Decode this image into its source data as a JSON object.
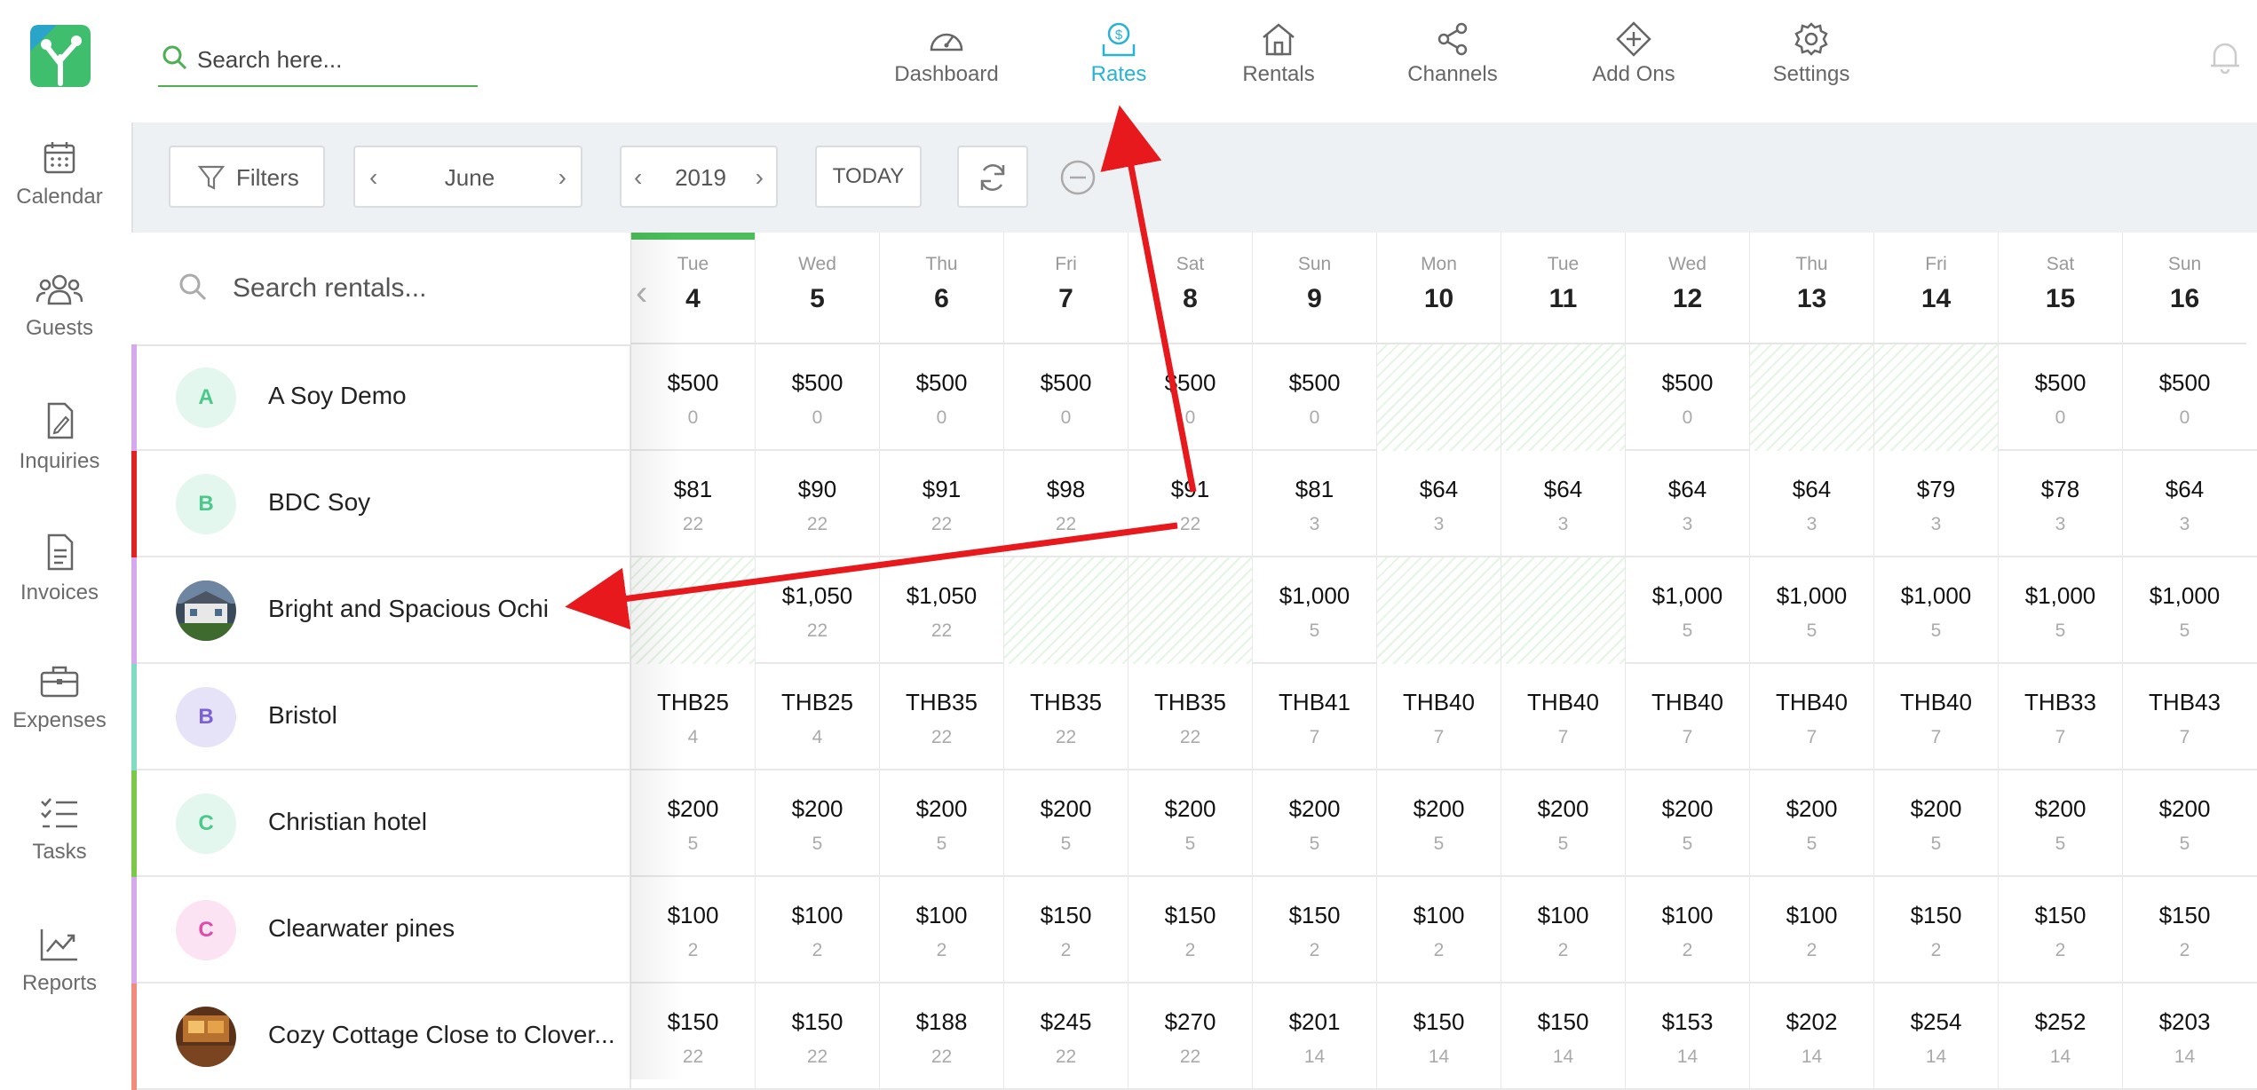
{
  "search": {
    "placeholder": "Search here..."
  },
  "sidebar": {
    "items": [
      {
        "label": "Calendar",
        "icon": "calendar-icon"
      },
      {
        "label": "Guests",
        "icon": "guests-icon"
      },
      {
        "label": "Inquiries",
        "icon": "inquiries-icon"
      },
      {
        "label": "Invoices",
        "icon": "invoices-icon"
      },
      {
        "label": "Expenses",
        "icon": "expenses-icon"
      },
      {
        "label": "Tasks",
        "icon": "tasks-icon"
      },
      {
        "label": "Reports",
        "icon": "reports-icon"
      }
    ]
  },
  "nav": {
    "items": [
      {
        "label": "Dashboard",
        "icon": "dashboard-icon"
      },
      {
        "label": "Rates",
        "icon": "rates-icon",
        "active": true
      },
      {
        "label": "Rentals",
        "icon": "rentals-icon"
      },
      {
        "label": "Channels",
        "icon": "channels-icon"
      },
      {
        "label": "Add Ons",
        "icon": "add-ons-icon"
      },
      {
        "label": "Settings",
        "icon": "settings-icon"
      }
    ],
    "active_color": "#28b3d3"
  },
  "toolbar": {
    "filters_label": "Filters",
    "month": "June",
    "year": "2019",
    "today_label": "TODAY"
  },
  "grid": {
    "rental_search_placeholder": "Search rentals...",
    "days": [
      {
        "dow": "Tue",
        "num": "4"
      },
      {
        "dow": "Wed",
        "num": "5"
      },
      {
        "dow": "Thu",
        "num": "6"
      },
      {
        "dow": "Fri",
        "num": "7"
      },
      {
        "dow": "Sat",
        "num": "8"
      },
      {
        "dow": "Sun",
        "num": "9"
      },
      {
        "dow": "Mon",
        "num": "10"
      },
      {
        "dow": "Tue",
        "num": "11"
      },
      {
        "dow": "Wed",
        "num": "12"
      },
      {
        "dow": "Thu",
        "num": "13"
      },
      {
        "dow": "Fri",
        "num": "14"
      },
      {
        "dow": "Sat",
        "num": "15"
      },
      {
        "dow": "Sun",
        "num": "16"
      }
    ],
    "rentals": [
      {
        "name": "A Soy Demo",
        "avatar": "A",
        "strip": "#d6a8ee",
        "avatar_bg": "#e3f7ee",
        "avatar_fg": "#4cc98a",
        "cells": [
          [
            "$500",
            "0"
          ],
          [
            "$500",
            "0"
          ],
          [
            "$500",
            "0"
          ],
          [
            "$500",
            "0"
          ],
          [
            "$500",
            "0"
          ],
          [
            "$500",
            "0"
          ],
          null,
          null,
          [
            "$500",
            "0"
          ],
          null,
          null,
          [
            "$500",
            "0"
          ],
          [
            "$500",
            "0"
          ]
        ]
      },
      {
        "name": "BDC Soy",
        "avatar": "B",
        "strip": "#e02424",
        "avatar_bg": "#e3f7ee",
        "avatar_fg": "#4cc98a",
        "cells": [
          [
            "$81",
            "22"
          ],
          [
            "$90",
            "22"
          ],
          [
            "$91",
            "22"
          ],
          [
            "$98",
            "22"
          ],
          [
            "$91",
            "22"
          ],
          [
            "$81",
            "3"
          ],
          [
            "$64",
            "3"
          ],
          [
            "$64",
            "3"
          ],
          [
            "$64",
            "3"
          ],
          [
            "$64",
            "3"
          ],
          [
            "$79",
            "3"
          ],
          [
            "$78",
            "3"
          ],
          [
            "$64",
            "3"
          ]
        ]
      },
      {
        "name": "Bright and Spacious Ochi",
        "avatar": "",
        "photo": true,
        "strip": "#d6a8ee",
        "cells": [
          null,
          [
            "$1,050",
            "22"
          ],
          [
            "$1,050",
            "22"
          ],
          null,
          null,
          [
            "$1,000",
            "5"
          ],
          null,
          null,
          [
            "$1,000",
            "5"
          ],
          [
            "$1,000",
            "5"
          ],
          [
            "$1,000",
            "5"
          ],
          [
            "$1,000",
            "5"
          ],
          [
            "$1,000",
            "5"
          ]
        ]
      },
      {
        "name": "Bristol",
        "avatar": "B",
        "strip": "#7fdcc2",
        "avatar_bg": "#e6e2f8",
        "avatar_fg": "#7d5fd8",
        "cells": [
          [
            "THB25",
            "4"
          ],
          [
            "THB25",
            "4"
          ],
          [
            "THB35",
            "22"
          ],
          [
            "THB35",
            "22"
          ],
          [
            "THB35",
            "22"
          ],
          [
            "THB41",
            "7"
          ],
          [
            "THB40",
            "7"
          ],
          [
            "THB40",
            "7"
          ],
          [
            "THB40",
            "7"
          ],
          [
            "THB40",
            "7"
          ],
          [
            "THB40",
            "7"
          ],
          [
            "THB33",
            "7"
          ],
          [
            "THB43",
            "7"
          ]
        ]
      },
      {
        "name": "Christian hotel",
        "avatar": "C",
        "strip": "#7cc84a",
        "avatar_bg": "#e3f7ee",
        "avatar_fg": "#4cc98a",
        "cells": [
          [
            "$200",
            "5"
          ],
          [
            "$200",
            "5"
          ],
          [
            "$200",
            "5"
          ],
          [
            "$200",
            "5"
          ],
          [
            "$200",
            "5"
          ],
          [
            "$200",
            "5"
          ],
          [
            "$200",
            "5"
          ],
          [
            "$200",
            "5"
          ],
          [
            "$200",
            "5"
          ],
          [
            "$200",
            "5"
          ],
          [
            "$200",
            "5"
          ],
          [
            "$200",
            "5"
          ],
          [
            "$200",
            "5"
          ]
        ]
      },
      {
        "name": "Clearwater pines",
        "avatar": "C",
        "strip": "#d6a8ee",
        "avatar_bg": "#fbe3f3",
        "avatar_fg": "#e04aa8",
        "cells": [
          [
            "$100",
            "2"
          ],
          [
            "$100",
            "2"
          ],
          [
            "$100",
            "2"
          ],
          [
            "$150",
            "2"
          ],
          [
            "$150",
            "2"
          ],
          [
            "$150",
            "2"
          ],
          [
            "$100",
            "2"
          ],
          [
            "$100",
            "2"
          ],
          [
            "$100",
            "2"
          ],
          [
            "$100",
            "2"
          ],
          [
            "$150",
            "2"
          ],
          [
            "$150",
            "2"
          ],
          [
            "$150",
            "2"
          ]
        ]
      },
      {
        "name": "Cozy Cottage Close to Clover...",
        "avatar": "",
        "photo": true,
        "strip": "#f08c7e",
        "cells": [
          [
            "$150",
            "22"
          ],
          [
            "$150",
            "22"
          ],
          [
            "$188",
            "22"
          ],
          [
            "$245",
            "22"
          ],
          [
            "$270",
            "22"
          ],
          [
            "$201",
            "14"
          ],
          [
            "$150",
            "14"
          ],
          [
            "$150",
            "14"
          ],
          [
            "$153",
            "14"
          ],
          [
            "$202",
            "14"
          ],
          [
            "$254",
            "14"
          ],
          [
            "$252",
            "14"
          ],
          [
            "$203",
            "14"
          ]
        ]
      }
    ]
  }
}
